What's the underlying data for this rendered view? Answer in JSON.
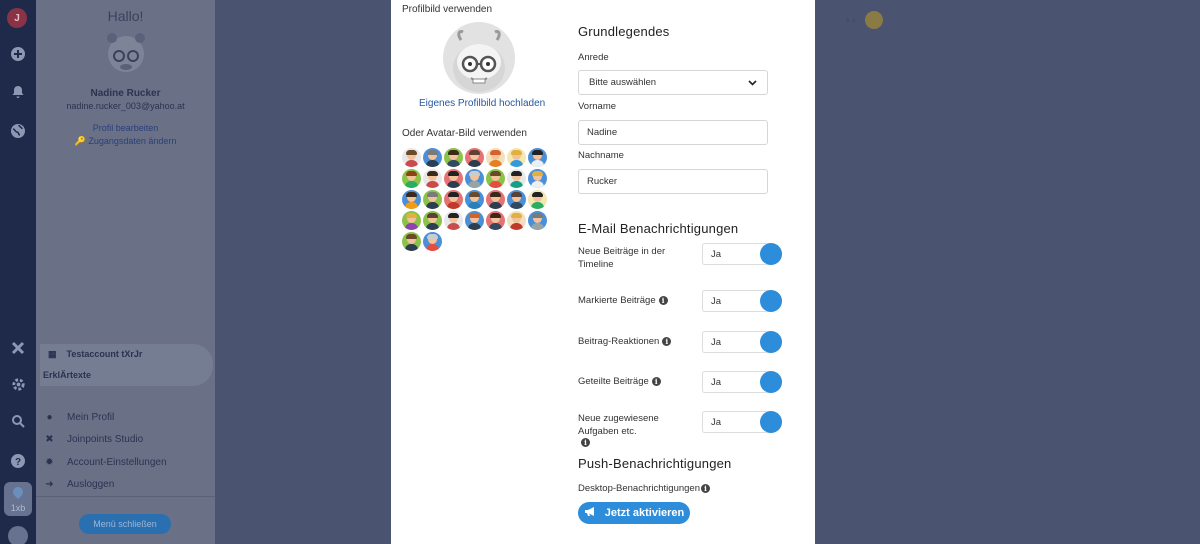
{
  "rail": {
    "logo_badge": "J",
    "app_tile_label": "1xb"
  },
  "sidebar": {
    "greeting": "Hallo!",
    "user_name": "Nadine Rucker",
    "user_email": "nadine.rucker_003@yahoo.at",
    "edit_profile": "Profil bearbeiten",
    "change_credentials": "Zugangsdaten ändern",
    "account_name": "Testaccount tXrJr",
    "account_sub": "ErklÄrtexte",
    "menu": [
      {
        "icon": "user-icon",
        "label": "Mein Profil"
      },
      {
        "icon": "tools-icon",
        "label": "Joinpoints Studio"
      },
      {
        "icon": "gear-icon",
        "label": "Account-Einstellungen"
      },
      {
        "icon": "logout-icon",
        "label": "Ausloggen"
      }
    ],
    "close_menu": "Menü schließen"
  },
  "modal": {
    "profile_pic_label": "Profilbild verwenden",
    "upload_label": "Eigenes Profilbild hochladen",
    "avatar_label": "Oder Avatar-Bild verwenden",
    "avatars": [
      {
        "bg": "#e8e8e8",
        "hair": "#6b4a2a",
        "shirt": "#c94b4b"
      },
      {
        "bg": "#4a90d9",
        "hair": "#7a7a7a",
        "shirt": "#2c3e50"
      },
      {
        "bg": "#8bc34a",
        "hair": "#3b2a1a",
        "shirt": "#34495e"
      },
      {
        "bg": "#e57373",
        "hair": "#5d4037",
        "shirt": "#2c3e50"
      },
      {
        "bg": "#f0e0c0",
        "hair": "#d4622a",
        "shirt": "#e67e22"
      },
      {
        "bg": "#f4e7b0",
        "hair": "#e0b040",
        "shirt": "#3498db"
      },
      {
        "bg": "#4a90d9",
        "hair": "#222222",
        "shirt": "#ecf0f1"
      },
      {
        "bg": "#8bc34a",
        "hair": "#8b4513",
        "shirt": "#27ae60"
      },
      {
        "bg": "#e8e8e8",
        "hair": "#3b2a1a",
        "shirt": "#c94b4b"
      },
      {
        "bg": "#e57373",
        "hair": "#222222",
        "shirt": "#2c3e50"
      },
      {
        "bg": "#4a90d9",
        "hair": "#cccccc",
        "shirt": "#95a5a6"
      },
      {
        "bg": "#8bc34a",
        "hair": "#6b4a2a",
        "shirt": "#e74c3c"
      },
      {
        "bg": "#e8e8e8",
        "hair": "#222222",
        "shirt": "#16a085"
      },
      {
        "bg": "#4a90d9",
        "hair": "#e0b040",
        "shirt": "#ecf0f1"
      },
      {
        "bg": "#4a90d9",
        "hair": "#3b2a1a",
        "shirt": "#f39c12"
      },
      {
        "bg": "#8bc34a",
        "hair": "#7a7a7a",
        "shirt": "#2c3e50"
      },
      {
        "bg": "#e57373",
        "hair": "#222222",
        "shirt": "#c0392b"
      },
      {
        "bg": "#4a90d9",
        "hair": "#6b4a2a",
        "shirt": "#2980b9"
      },
      {
        "bg": "#e57373",
        "hair": "#3b2a1a",
        "shirt": "#2c3e50"
      },
      {
        "bg": "#4a90d9",
        "hair": "#5d4037",
        "shirt": "#34495e"
      },
      {
        "bg": "#f4e7b0",
        "hair": "#222222",
        "shirt": "#27ae60"
      },
      {
        "bg": "#8bc34a",
        "hair": "#e0b040",
        "shirt": "#8e44ad"
      },
      {
        "bg": "#8bc34a",
        "hair": "#5d4037",
        "shirt": "#2c3e50"
      },
      {
        "bg": "#e8e8e8",
        "hair": "#222222",
        "shirt": "#c94b4b"
      },
      {
        "bg": "#4a90d9",
        "hair": "#d4622a",
        "shirt": "#2c3e50"
      },
      {
        "bg": "#e57373",
        "hair": "#3b2a1a",
        "shirt": "#34495e"
      },
      {
        "bg": "#f0e0c0",
        "hair": "#e0b040",
        "shirt": "#c0392b"
      },
      {
        "bg": "#4a90d9",
        "hair": "#7a7a7a",
        "shirt": "#95a5a6"
      },
      {
        "bg": "#8bc34a",
        "hair": "#6b4a2a",
        "shirt": "#2c3e50"
      },
      {
        "bg": "#4a90d9",
        "hair": "#cccccc",
        "shirt": "#e74c3c"
      }
    ],
    "section_basic": "Grundlegendes",
    "salutation_label": "Anrede",
    "salutation_value": "Bitte auswählen",
    "firstname_label": "Vorname",
    "firstname_value": "Nadine",
    "lastname_label": "Nachname",
    "lastname_value": "Rucker",
    "section_email": "E-Mail Benachrichtigungen",
    "notifications": [
      {
        "label": "Neue Beiträge in der Timeline",
        "info": false,
        "value": "Ja"
      },
      {
        "label": "Markierte Beiträge",
        "info": true,
        "value": "Ja"
      },
      {
        "label": "Beitrag-Reaktionen",
        "info": true,
        "value": "Ja"
      },
      {
        "label": "Geteilte Beiträge",
        "info": true,
        "value": "Ja"
      },
      {
        "label": "Neue zugewiesene Aufgaben etc.",
        "info": true,
        "value": "Ja"
      }
    ],
    "section_push": "Push-Benachrichtigungen",
    "desktop_label": "Desktop-Benachrichtigungen",
    "activate_button": "Jetzt aktivieren"
  },
  "colors": {
    "accent": "#2d8ddb",
    "link": "#2557a0",
    "overlay": "#4a5470",
    "rail": "#1f2a4a"
  }
}
